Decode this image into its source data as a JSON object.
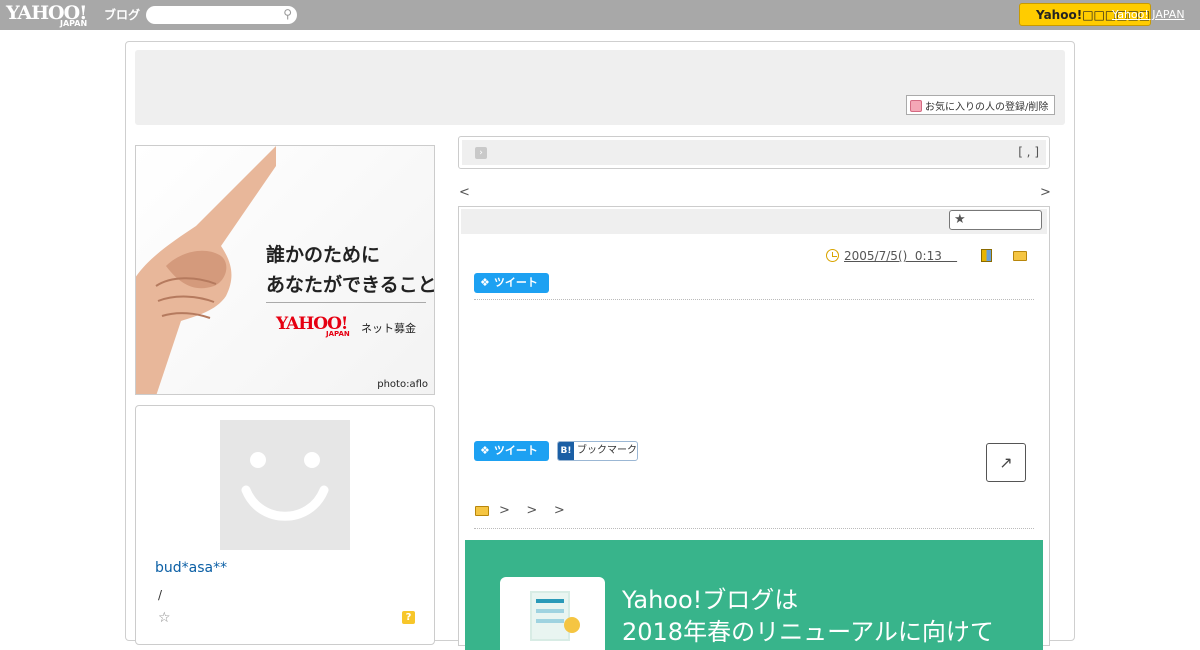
{
  "topbar": {
    "logo_text": "YAHOO!",
    "logo_sub": "JAPAN",
    "logo_blog": "ブログ",
    "search_placeholder": "",
    "yj_button": "Yahoo!□□□□□□□",
    "yj_link": "Yahoo! JAPAN"
  },
  "header": {
    "fav_button": "お気に入りの人の登録/削除"
  },
  "banner": {
    "line1": "誰かのために",
    "line2": "あなたができること",
    "brand": "YAHOO!",
    "brand_sub": "JAPAN",
    "service": "ネット募金",
    "credit": "photo:aflo"
  },
  "profile": {
    "username": "bud*asa**",
    "slash": "/",
    "help": "?"
  },
  "category_bar": {
    "bracket": "[ , ]"
  },
  "nav": {
    "prev": "<",
    "next": ">"
  },
  "article": {
    "date": "2005/7/5()  0:13    ",
    "tweet_label": "ツイート",
    "bookmark_label": "ブックマーク",
    "bookmark_badge": "B!",
    "breadcrumb": ">    >    >"
  },
  "promo": {
    "line1": "Yahoo!ブログは",
    "line2": "2018年春のリニューアルに向けて"
  },
  "colors": {
    "topbar": "#a8a8a8",
    "yj_button": "#ffcc00",
    "tweet": "#1da1f2",
    "promo": "#38b48b",
    "username": "#0b5fa5"
  }
}
